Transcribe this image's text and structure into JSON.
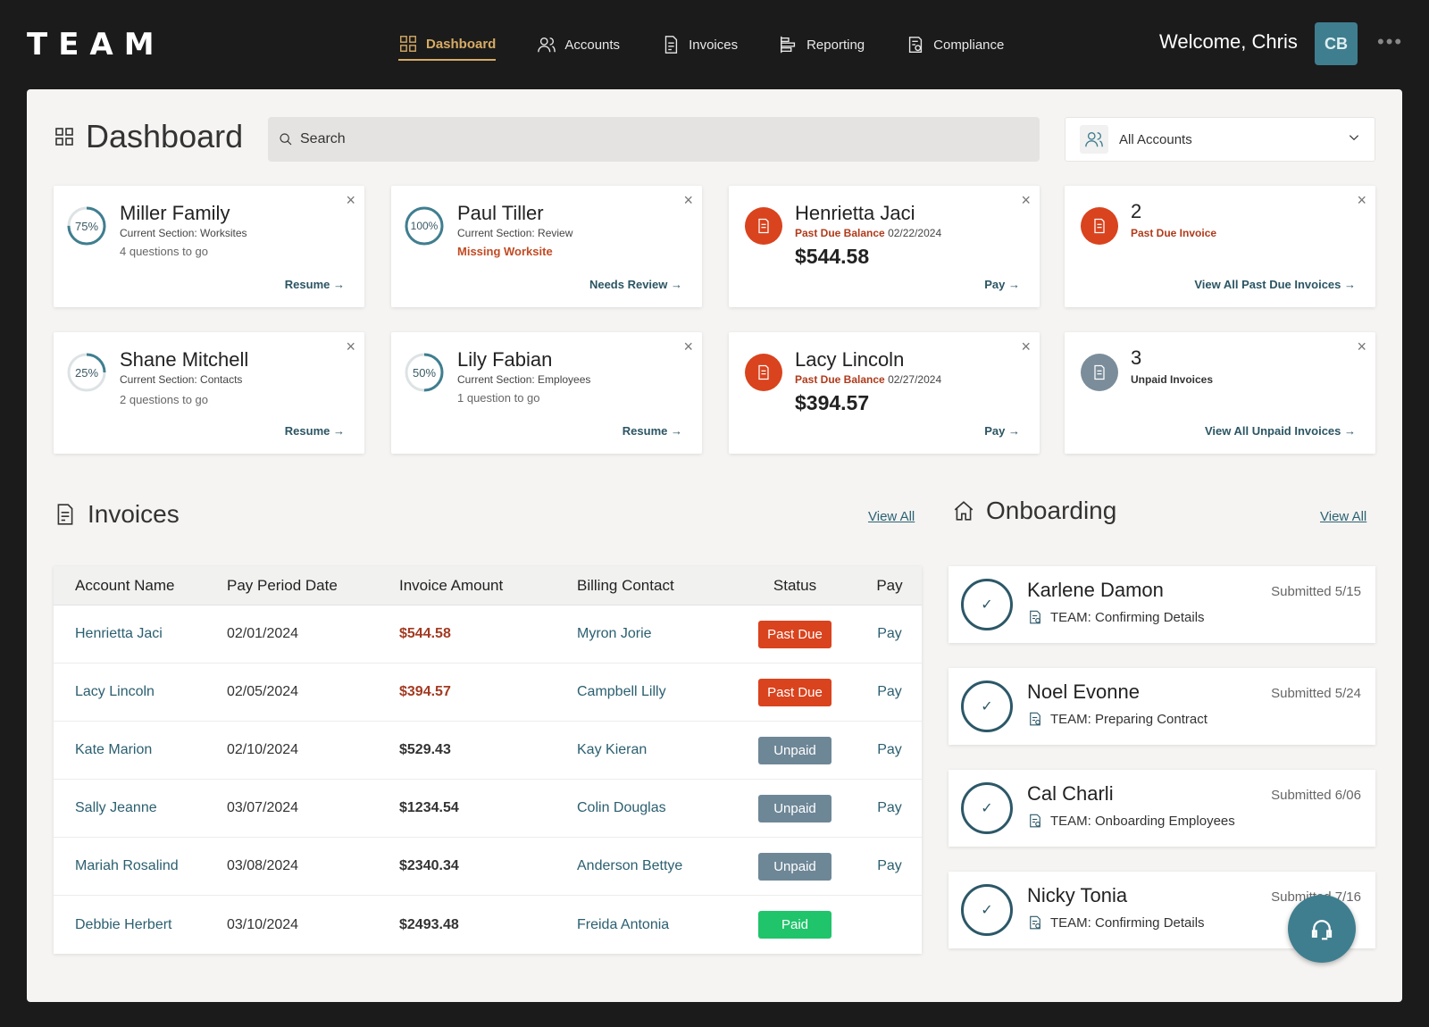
{
  "brand": "TEAM",
  "nav": [
    {
      "label": "Dashboard",
      "active": true
    },
    {
      "label": "Accounts"
    },
    {
      "label": "Invoices"
    },
    {
      "label": "Reporting"
    },
    {
      "label": "Compliance"
    }
  ],
  "user": {
    "welcome": "Welcome, Chris",
    "initials": "CB",
    "more": "•••"
  },
  "page_title": "Dashboard",
  "search": {
    "placeholder": "Search"
  },
  "account_filter": {
    "label": "All Accounts"
  },
  "cards": {
    "miller": {
      "percent": "75%",
      "progress": 0.75,
      "name": "Miller Family",
      "section": "Current Section: Worksites",
      "remaining": "4 questions to go",
      "action": "Resume →"
    },
    "tiller": {
      "percent": "100%",
      "progress": 1.0,
      "name": "Paul Tiller",
      "section": "Current Section: Review",
      "warning": "Missing Worksite",
      "action": "Needs Review →"
    },
    "henrietta": {
      "name": "Henrietta Jaci",
      "due_label": "Past Due Balance",
      "due_date": "02/22/2024",
      "amount": "$544.58",
      "action": "Pay →"
    },
    "past_due": {
      "count": "2",
      "label": "Past Due Invoice",
      "action": "View All Past Due Invoices →"
    },
    "shane": {
      "percent": "25%",
      "progress": 0.25,
      "name": "Shane Mitchell",
      "section": "Current Section: Contacts",
      "remaining": "2 questions to go",
      "action": "Resume →"
    },
    "lily": {
      "percent": "50%",
      "progress": 0.5,
      "name": "Lily Fabian",
      "section": "Current Section: Employees",
      "remaining": "1 question to go",
      "action": "Resume →"
    },
    "lacy": {
      "name": "Lacy Lincoln",
      "due_label": "Past Due Balance",
      "due_date": "02/27/2024",
      "amount": "$394.57",
      "action": "Pay →"
    },
    "unpaid": {
      "count": "3",
      "label": "Unpaid Invoices",
      "action": "View All Unpaid Invoices →"
    },
    "close": "×"
  },
  "invoices": {
    "title": "Invoices",
    "view_all": "View All",
    "headers": [
      "Account Name",
      "Pay Period Date",
      "Invoice Amount",
      "Billing Contact",
      "Status",
      "Pay"
    ],
    "rows": [
      {
        "account": "Henrietta Jaci",
        "date": "02/01/2024",
        "amount": "$544.58",
        "contact": "Myron Jorie",
        "status": "Past Due",
        "pay": "Pay"
      },
      {
        "account": "Lacy Lincoln",
        "date": "02/05/2024",
        "amount": "$394.57",
        "contact": "Campbell Lilly",
        "status": "Past Due",
        "pay": "Pay"
      },
      {
        "account": "Kate Marion",
        "date": "02/10/2024",
        "amount": "$529.43",
        "contact": "Kay Kieran",
        "status": "Unpaid",
        "pay": "Pay"
      },
      {
        "account": "Sally Jeanne",
        "date": "03/07/2024",
        "amount": "$1234.54",
        "contact": "Colin Douglas",
        "status": "Unpaid",
        "pay": "Pay"
      },
      {
        "account": "Mariah Rosalind",
        "date": "03/08/2024",
        "amount": "$2340.34",
        "contact": "Anderson Bettye",
        "status": "Unpaid",
        "pay": "Pay"
      },
      {
        "account": "Debbie Herbert",
        "date": "03/10/2024",
        "amount": "$2493.48",
        "contact": "Freida Antonia",
        "status": "Paid",
        "pay": ""
      }
    ]
  },
  "onboarding": {
    "title": "Onboarding",
    "view_all": "View All",
    "items": [
      {
        "name": "Karlene Damon",
        "submitted": "Submitted 5/15",
        "status": "TEAM: Confirming Details"
      },
      {
        "name": "Noel Evonne",
        "submitted": "Submitted 5/24",
        "status": "TEAM: Preparing Contract"
      },
      {
        "name": "Cal Charli",
        "submitted": "Submitted 6/06",
        "status": "TEAM: Onboarding Employees"
      },
      {
        "name": "Nicky Tonia",
        "submitted": "Submitted 7/16",
        "status": "TEAM: Confirming Details"
      }
    ]
  },
  "colors": {
    "accent": "#d7ab65",
    "teal": "#3f7e8f",
    "past_due": "#d9431e",
    "unpaid": "#6e8797",
    "paid": "#20c46b",
    "alert_icon": "#d9431e",
    "neutral_icon": "#7b8d9a"
  },
  "icons": {
    "nav": [
      "dashboard-grid-icon",
      "accounts-users-icon",
      "invoices-document-icon",
      "reporting-chart-icon",
      "compliance-checklist-icon"
    ],
    "chat": "chat-support-icon"
  }
}
